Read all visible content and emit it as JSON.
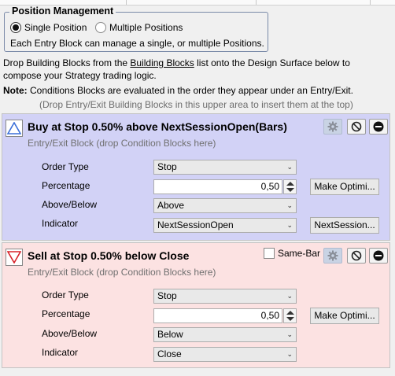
{
  "position_management": {
    "legend": "Position Management",
    "options": [
      {
        "label": "Single Position",
        "selected": true
      },
      {
        "label": "Multiple Positions",
        "selected": false
      }
    ],
    "description": "Each Entry Block can manage a single, or multiple Positions."
  },
  "instructions": {
    "line1_pre": "Drop Building Blocks from the ",
    "line1_link": "Building Blocks",
    "line1_post": " list onto the Design Surface below to",
    "line2": "compose your Strategy trading logic.",
    "note_label": "Note:",
    "note_text": " Conditions Blocks are evaluated in the order they appear under an Entry/Exit.",
    "hint": "(Drop Entry/Exit Building Blocks in this upper area to insert them at the top)"
  },
  "blocks": [
    {
      "title": "Buy at Stop 0.50% above NextSessionOpen(Bars)",
      "subtitle": "Entry/Exit Block (drop Condition Blocks here)",
      "colors": {
        "background": "#d2d2f6",
        "shape": "#3a6fd8"
      },
      "params": {
        "order_type_label": "Order Type",
        "order_type_value": "Stop",
        "percentage_label": "Percentage",
        "percentage_value": "0,50",
        "above_below_label": "Above/Below",
        "above_below_value": "Above",
        "indicator_label": "Indicator",
        "indicator_value": "NextSessionOpen"
      },
      "optimize_label": "Make Optimi...",
      "indicator_button_label": "NextSession..."
    },
    {
      "title": "Sell at Stop 0.50% below Close",
      "subtitle": "Entry/Exit Block (drop Condition Blocks here)",
      "colors": {
        "background": "#fce2e2",
        "shape": "#d8232a"
      },
      "same_bar_label": "Same-Bar",
      "params": {
        "order_type_label": "Order Type",
        "order_type_value": "Stop",
        "percentage_label": "Percentage",
        "percentage_value": "0,50",
        "above_below_label": "Above/Below",
        "above_below_value": "Below",
        "indicator_label": "Indicator",
        "indicator_value": "Close"
      },
      "optimize_label": "Make Optimi..."
    }
  ]
}
